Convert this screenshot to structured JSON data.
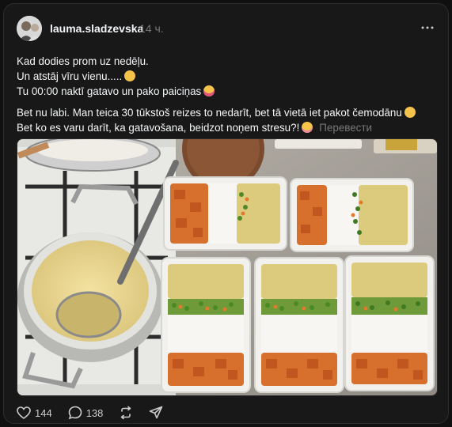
{
  "post": {
    "author": {
      "username": "lauma.sladzevska",
      "time": "14 ч."
    },
    "text": {
      "paragraph1": [
        "Kad dodies prom uz nedēļu.",
        "Un atstāj vīru vienu.....",
        "Tu 00:00 naktī gatavo un pako paiciņas"
      ],
      "paragraph2": [
        "Bet nu labi. Man teica 30 tūkstoš reizes to nedarīt, bet tā vietā iet pakot čemodānu",
        "Bet ko es varu darīt, ka gatavošana, beidzot noņem stresu?!"
      ],
      "translate_label": "Перевести"
    },
    "image": {
      "description_icon": "meal-prep-photo"
    },
    "actions": {
      "likes": "144",
      "comments": "138"
    }
  },
  "icons": {
    "more": "more-horizontal-icon",
    "like": "heart-icon",
    "comment": "comment-bubble-icon",
    "repost": "repost-icon",
    "share": "send-icon"
  },
  "colors": {
    "background": "#101010",
    "card": "#181818",
    "text": "#f3f5f7",
    "muted": "#777777"
  }
}
